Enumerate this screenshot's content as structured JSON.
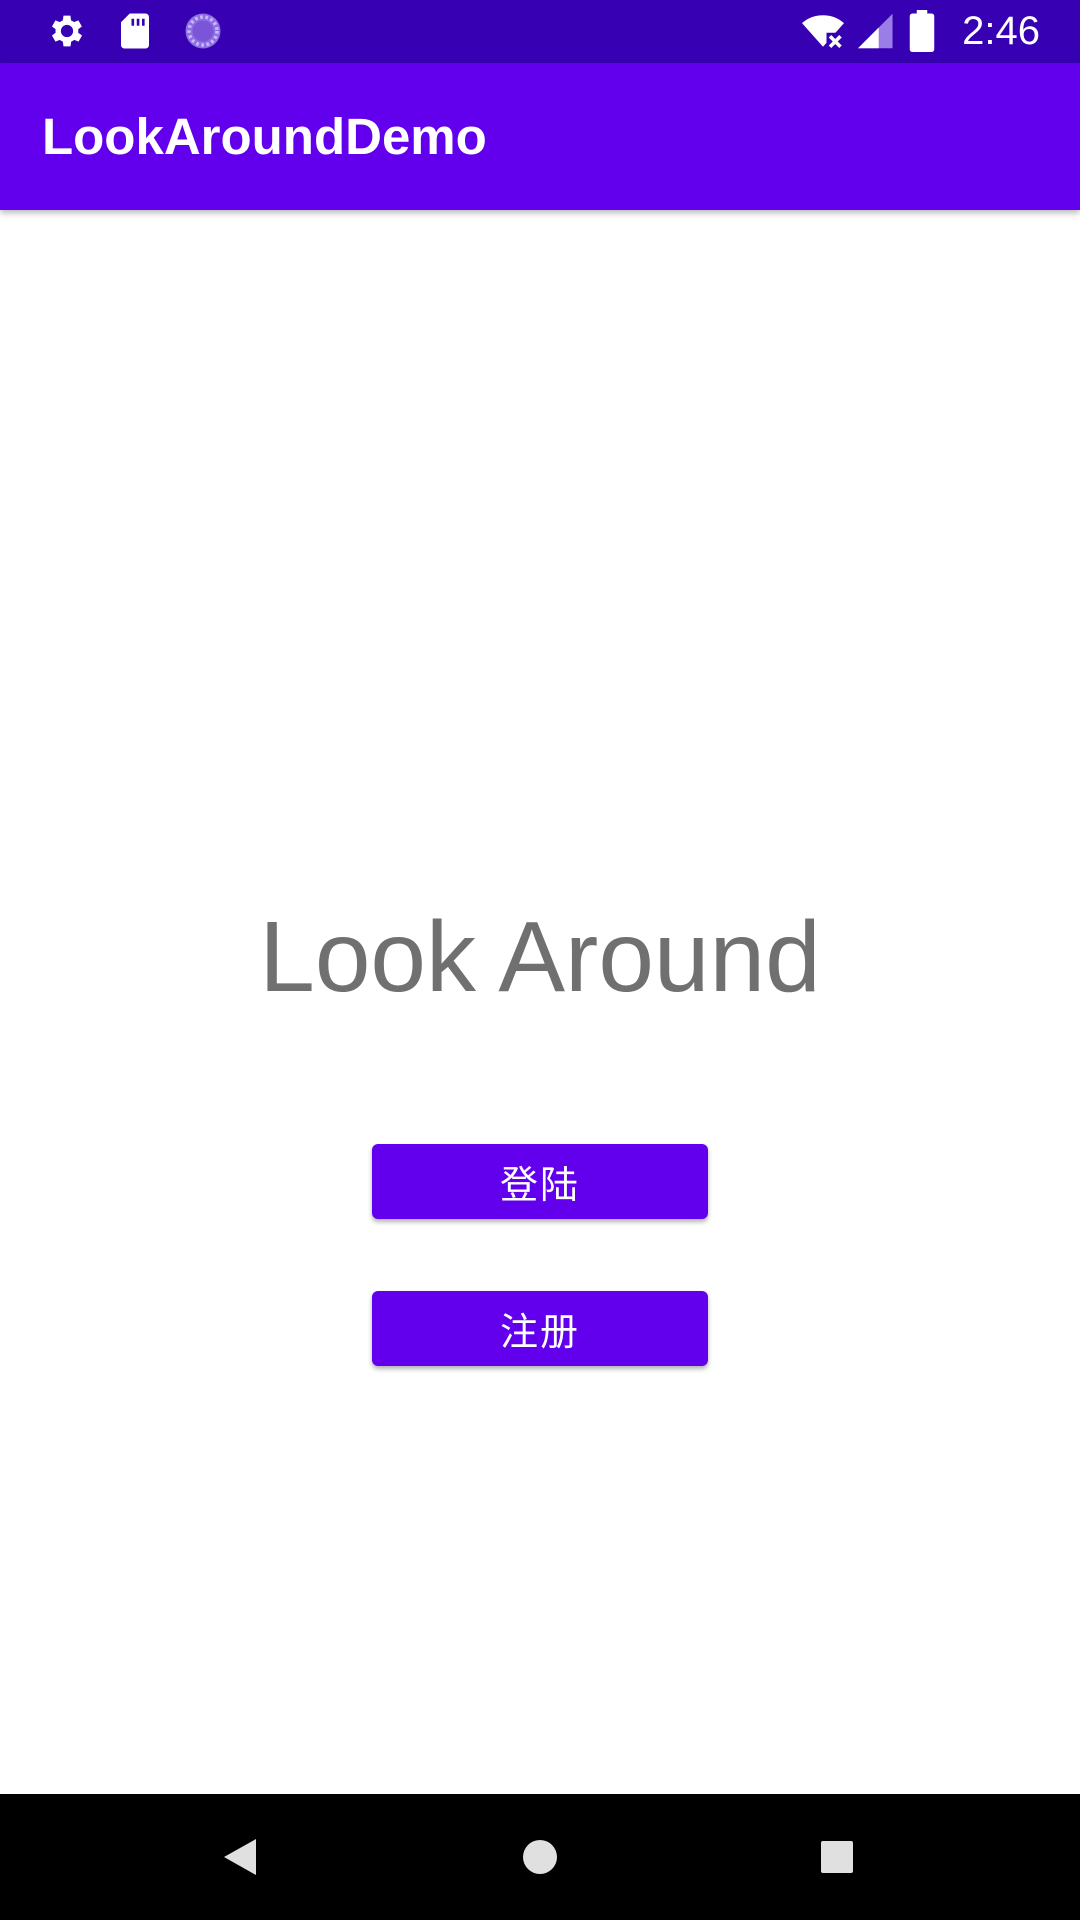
{
  "status_bar": {
    "time": "2:46",
    "left_icons": [
      "settings-gear-icon",
      "sd-card-icon",
      "loading-spinner-icon"
    ],
    "right_icons": [
      "wifi-off-icon",
      "cell-signal-icon",
      "battery-icon"
    ],
    "background": "#3700b3"
  },
  "app_bar": {
    "title": "LookAroundDemo",
    "background": "#6200ee"
  },
  "main": {
    "headline": "Look Around",
    "login_button": "登陆",
    "register_button": "注册",
    "button_color": "#6200ee",
    "headline_color": "#707070"
  },
  "nav_bar": {
    "buttons": [
      "back-icon",
      "home-icon",
      "recents-icon"
    ]
  }
}
